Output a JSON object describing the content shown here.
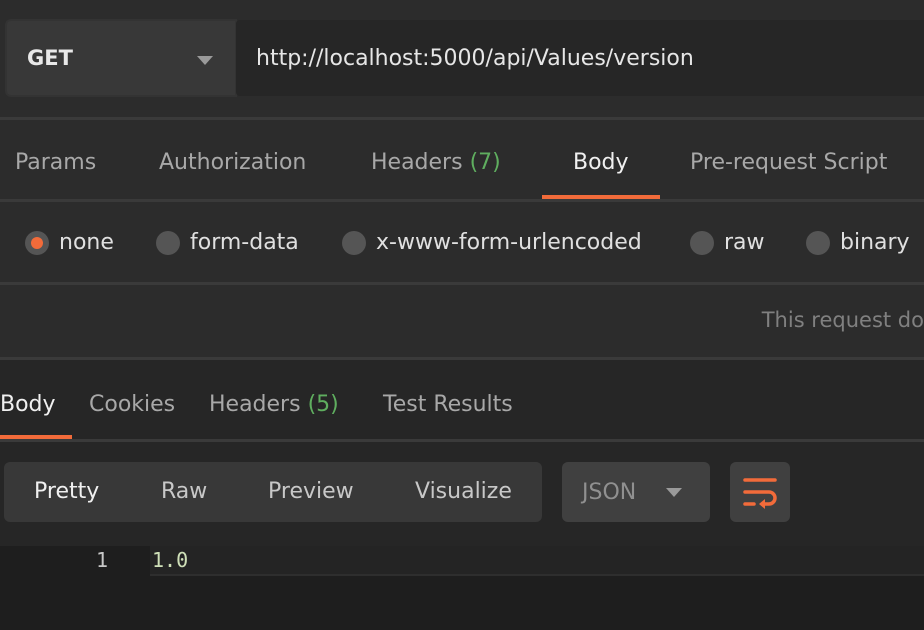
{
  "request": {
    "method": "GET",
    "url": "http://localhost:5000/api/Values/version"
  },
  "request_tabs": [
    {
      "label": "Params"
    },
    {
      "label": "Authorization"
    },
    {
      "label": "Headers",
      "count": "(7)"
    },
    {
      "label": "Body",
      "active": true
    },
    {
      "label": "Pre-request Script"
    }
  ],
  "body_types": [
    {
      "label": "none",
      "selected": true
    },
    {
      "label": "form-data"
    },
    {
      "label": "x-www-form-urlencoded"
    },
    {
      "label": "raw"
    },
    {
      "label": "binary"
    }
  ],
  "body_message": "This request do",
  "response_tabs": [
    {
      "label": "Body",
      "active": true
    },
    {
      "label": "Cookies"
    },
    {
      "label": "Headers",
      "count": "(5)"
    },
    {
      "label": "Test Results"
    }
  ],
  "view_modes": [
    "Pretty",
    "Raw",
    "Preview",
    "Visualize"
  ],
  "format": "JSON",
  "wrap_icon": "wrap-lines-icon",
  "code": {
    "line_number": "1",
    "value": "1.0"
  },
  "colors": {
    "accent": "#f26b3a",
    "count": "#5fae5f"
  }
}
